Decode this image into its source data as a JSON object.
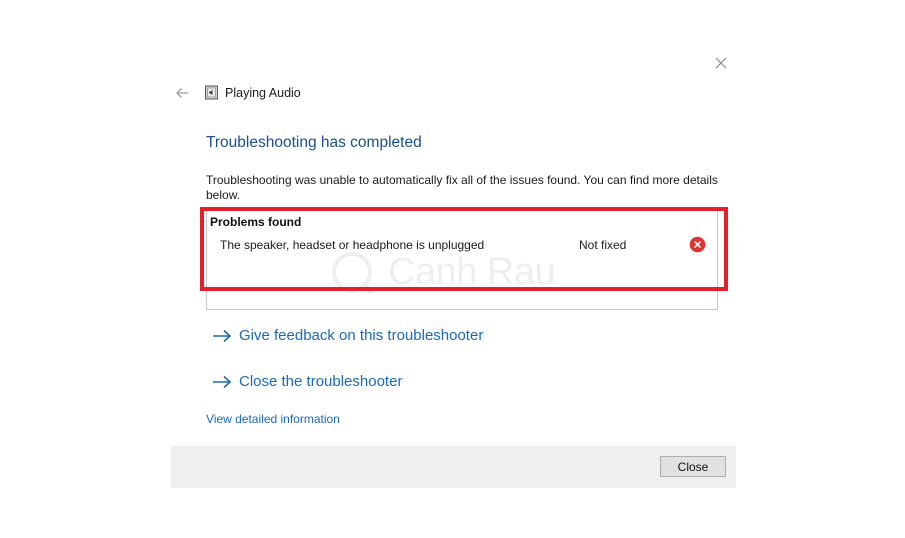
{
  "window": {
    "title": "Playing Audio",
    "app_icon": "speaker-file-icon",
    "back_icon": "back-arrow-icon",
    "close_icon": "close-icon"
  },
  "main": {
    "heading": "Troubleshooting has completed",
    "description": "Troubleshooting was unable to automatically fix all of the issues found. You can find more details below.",
    "problems": {
      "title": "Problems found",
      "items": [
        {
          "text": "The speaker, headset or headphone is unplugged",
          "status": "Not fixed",
          "status_icon": "error-icon"
        }
      ]
    },
    "links": {
      "feedback": "Give feedback on this troubleshooter",
      "close": "Close the troubleshooter",
      "details": "View detailed information"
    },
    "watermark": "Canh Rau"
  },
  "footer": {
    "close_button": "Close"
  },
  "colors": {
    "heading": "#1a4f91",
    "link": "#1a6ab8",
    "highlight": "#e4212b",
    "error": "#e0322f",
    "footer_bg": "#f0f0f0"
  }
}
